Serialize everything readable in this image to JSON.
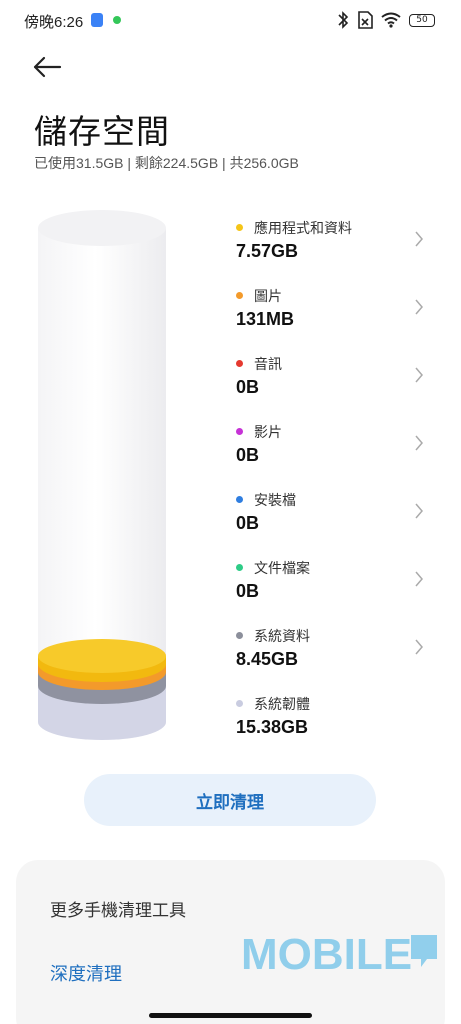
{
  "status_bar": {
    "time": "傍晚6:26",
    "battery": "50"
  },
  "header": {
    "title": "儲存空間",
    "summary": "已使用31.5GB | 剩餘224.5GB | 共256.0GB"
  },
  "categories": [
    {
      "label": "應用程式和資料",
      "value": "7.57GB",
      "color": "#f5c518"
    },
    {
      "label": "圖片",
      "value": "131MB",
      "color": "#f39a2b"
    },
    {
      "label": "音訊",
      "value": "0B",
      "color": "#e5392f"
    },
    {
      "label": "影片",
      "value": "0B",
      "color": "#c632d6"
    },
    {
      "label": "安裝檔",
      "value": "0B",
      "color": "#2f7ee0"
    },
    {
      "label": "文件檔案",
      "value": "0B",
      "color": "#2ecc87"
    },
    {
      "label": "系統資料",
      "value": "8.45GB",
      "color": "#8c8f9b"
    },
    {
      "label": "系統韌體",
      "value": "15.38GB",
      "color": "#c9cce0"
    }
  ],
  "actions": {
    "clean_now": "立即清理"
  },
  "tools": {
    "title": "更多手機清理工具",
    "deep_clean": "深度清理"
  },
  "watermark": "MOBILE"
}
